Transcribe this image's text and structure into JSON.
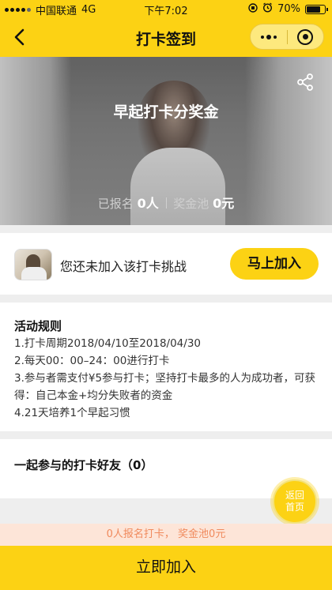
{
  "status_bar": {
    "carrier": "中国联通",
    "network": "4G",
    "time": "下午7:02",
    "battery": "70%"
  },
  "nav": {
    "title": "打卡签到"
  },
  "hero": {
    "title": "早起打卡分奖金",
    "signed_label": "已报名",
    "signed_value": "0人",
    "pool_label": "奖金池",
    "pool_value": "0元"
  },
  "join": {
    "text": "您还未加入该打卡挑战",
    "button": "马上加入"
  },
  "rules": {
    "title": "活动规则",
    "lines": [
      "1.打卡周期2018/04/10至2018/04/30",
      "2.每天00：00–24：00进行打卡",
      "3.参与者需支付¥5参与打卡；坚持打卡最多的人为成功者，可获得：自己本金+均分失败者的资金",
      "4.21天培养1个早起习惯"
    ]
  },
  "friends": {
    "title": "一起参与的打卡好友（0）"
  },
  "home_fab": {
    "line1": "返回",
    "line2": "首页"
  },
  "info_strip": "0人报名打卡， 奖金池0元",
  "bottom_button": "立即加入",
  "colors": {
    "brand_yellow": "#fcd214",
    "info_text": "#f08a5d",
    "info_bg": "#fde5d8"
  }
}
